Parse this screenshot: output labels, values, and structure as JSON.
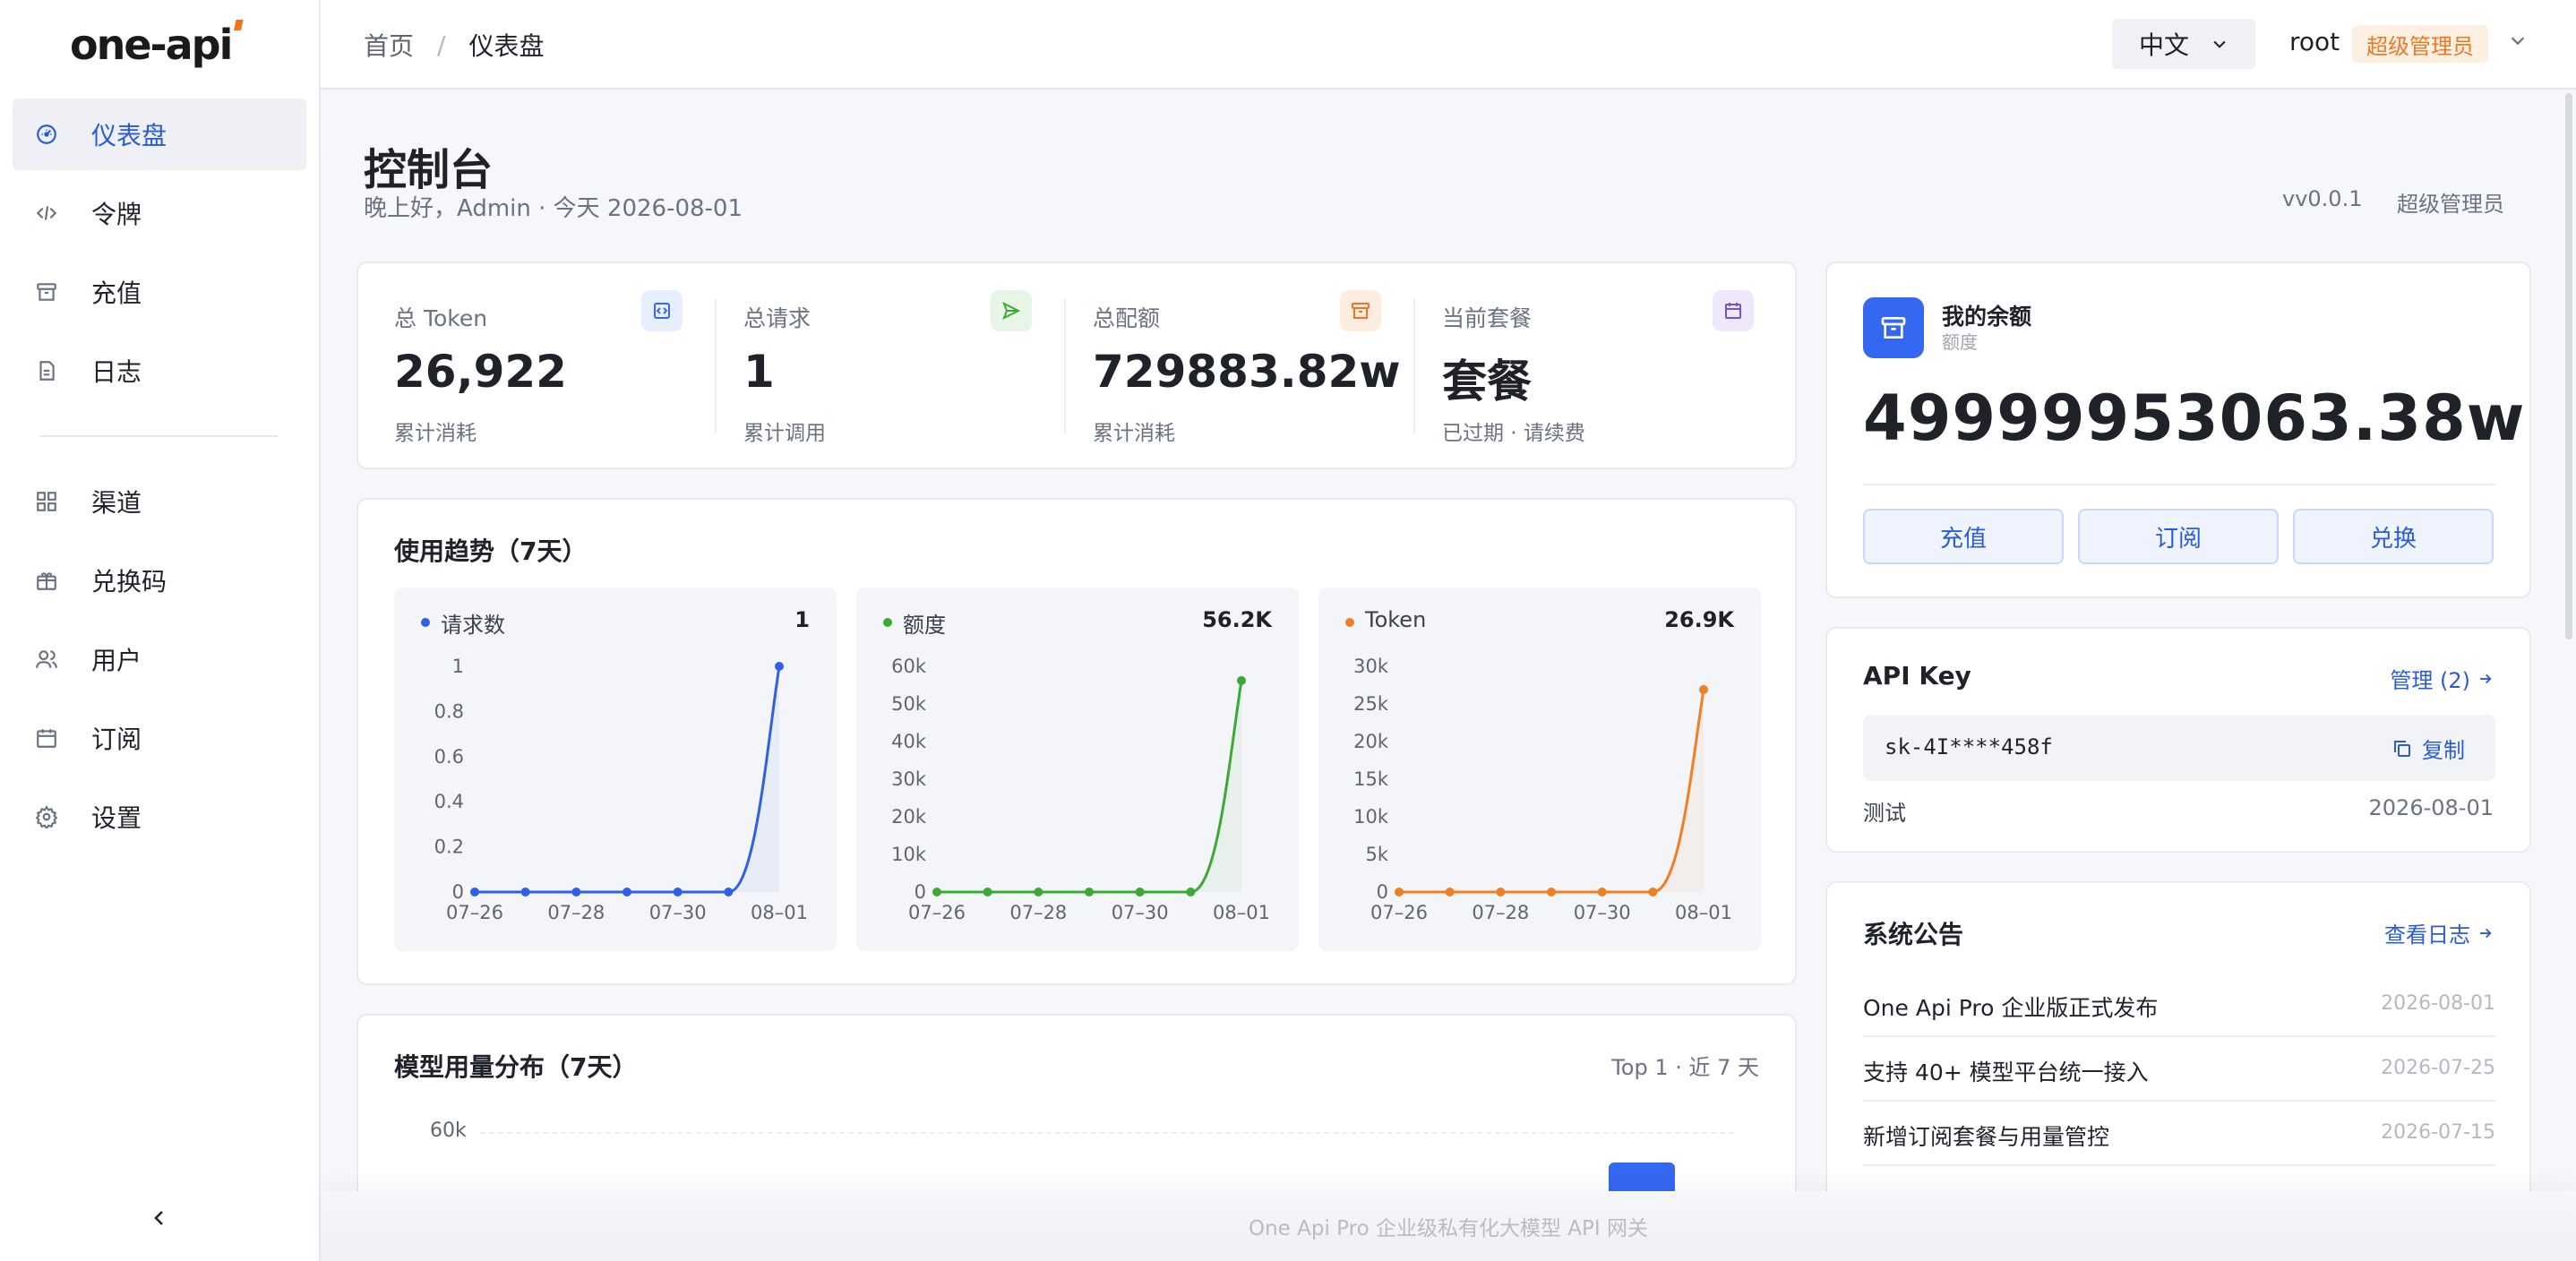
{
  "brand": {
    "logo_main": "one-api",
    "accent": "#f5731f"
  },
  "sidebar": {
    "items": [
      {
        "label": "仪表盘",
        "icon": "dashboard-icon",
        "active": true
      },
      {
        "label": "令牌",
        "icon": "code-icon"
      },
      {
        "label": "充值",
        "icon": "archive-icon"
      },
      {
        "label": "日志",
        "icon": "document-icon"
      },
      {
        "label": "渠道",
        "icon": "grid-icon"
      },
      {
        "label": "兑换码",
        "icon": "gift-icon"
      },
      {
        "label": "用户",
        "icon": "users-icon"
      },
      {
        "label": "订阅",
        "icon": "calendar-icon"
      },
      {
        "label": "设置",
        "icon": "gear-icon"
      }
    ]
  },
  "topbar": {
    "breadcrumb_home": "首页",
    "breadcrumb_sep": "/",
    "breadcrumb_current": "仪表盘",
    "language": "中文",
    "username": "root",
    "role_badge": "超级管理员"
  },
  "page": {
    "title": "控制台",
    "subtitle": "晚上好，Admin · 今天 2026-08-01",
    "version": "vv0.0.1",
    "role": "超级管理员"
  },
  "stats": [
    {
      "label": "总 Token",
      "value": "26,922",
      "note": "累计消耗",
      "icon": "token-icon",
      "color": "#3568f0"
    },
    {
      "label": "总请求",
      "value": "1",
      "note": "累计调用",
      "icon": "send-icon",
      "color": "#3aaa35"
    },
    {
      "label": "总配额",
      "value": "729883.82w",
      "note": "累计消耗",
      "icon": "archive-icon",
      "color": "#f5731f"
    },
    {
      "label": "当前套餐",
      "value": "套餐",
      "note": "已过期 · 请续费",
      "icon": "calendar-icon",
      "color": "#7a4fd6"
    }
  ],
  "trend": {
    "title": "使用趋势（7天）",
    "charts": [
      {
        "name": "请求数",
        "total": "1",
        "color": "#2f5fe6",
        "y_ticks": [
          "1",
          "0.8",
          "0.6",
          "0.4",
          "0.2",
          "0"
        ]
      },
      {
        "name": "额度",
        "total": "56.2K",
        "color": "#3aaa35",
        "y_ticks": [
          "60k",
          "50k",
          "40k",
          "30k",
          "20k",
          "10k",
          "0"
        ]
      },
      {
        "name": "Token",
        "total": "26.9K",
        "color": "#f07e22",
        "y_ticks": [
          "30k",
          "25k",
          "20k",
          "15k",
          "10k",
          "5k",
          "0"
        ]
      }
    ],
    "x_ticks": [
      "07–26",
      "07–28",
      "07–30",
      "08–01"
    ]
  },
  "model_usage": {
    "title": "模型用量分布（7天）",
    "meta": "Top 1 · 近 7 天",
    "y_tick": "60k",
    "bar_color": "#3568f0"
  },
  "balance": {
    "title": "我的余额",
    "subtitle": "额度",
    "value": "49999953063.38w",
    "buttons": [
      "充值",
      "订阅",
      "兑换"
    ]
  },
  "api_key": {
    "title": "API Key",
    "manage_link": "管理 (2)",
    "key": "sk-4I****458f",
    "copy_label": "复制",
    "name": "测试",
    "date": "2026-08-01"
  },
  "announcements": {
    "title": "系统公告",
    "link": "查看日志",
    "items": [
      {
        "title": "One Api Pro 企业版正式发布",
        "date": "2026-08-01"
      },
      {
        "title": "支持 40+ 模型平台统一接入",
        "date": "2026-07-25"
      },
      {
        "title": "新增订阅套餐与用量管控",
        "date": "2026-07-15"
      }
    ]
  },
  "footer": {
    "text": "One Api Pro 企业级私有化大模型 API 网关"
  },
  "chart_data": [
    {
      "type": "line",
      "title": "请求数",
      "x": [
        "07-26",
        "07-27",
        "07-28",
        "07-29",
        "07-30",
        "07-31",
        "08-01"
      ],
      "series": [
        {
          "name": "请求数",
          "values": [
            0,
            0,
            0,
            0,
            0,
            0,
            1
          ]
        }
      ],
      "ylim": [
        0,
        1
      ]
    },
    {
      "type": "line",
      "title": "额度",
      "x": [
        "07-26",
        "07-27",
        "07-28",
        "07-29",
        "07-30",
        "07-31",
        "08-01"
      ],
      "series": [
        {
          "name": "额度",
          "values": [
            0,
            0,
            0,
            0,
            0,
            0,
            56200
          ]
        }
      ],
      "ylim": [
        0,
        60000
      ]
    },
    {
      "type": "line",
      "title": "Token",
      "x": [
        "07-26",
        "07-27",
        "07-28",
        "07-29",
        "07-30",
        "07-31",
        "08-01"
      ],
      "series": [
        {
          "name": "Token",
          "values": [
            0,
            0,
            0,
            0,
            0,
            0,
            26900
          ]
        }
      ],
      "ylim": [
        0,
        30000
      ]
    }
  ]
}
